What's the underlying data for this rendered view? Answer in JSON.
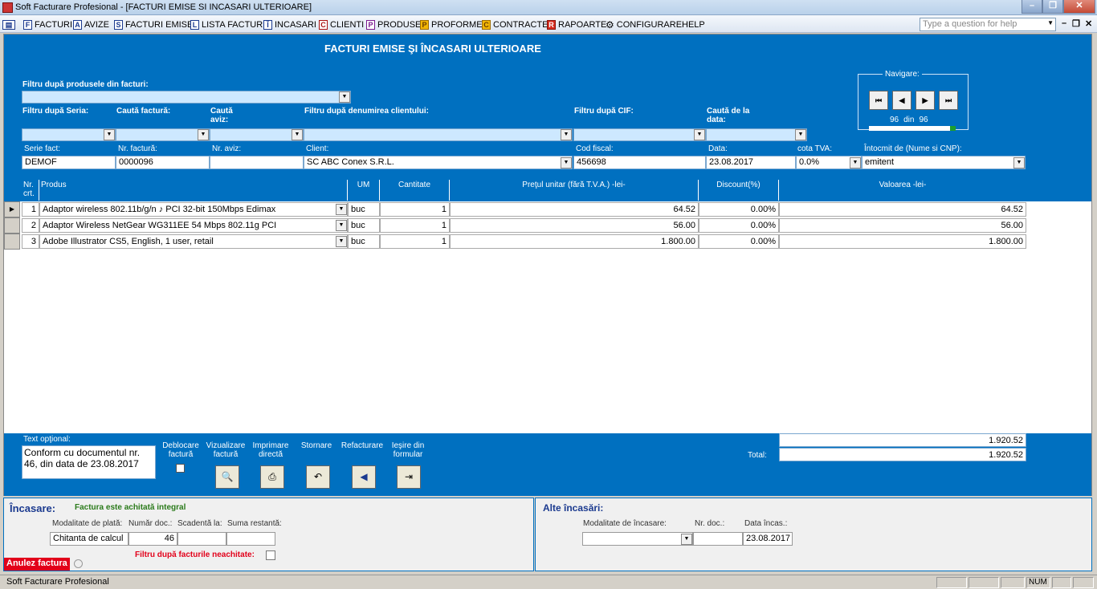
{
  "window": {
    "title": "Soft Facturare Profesional - [FACTURI EMISE SI INCASARI ULTERIOARE]"
  },
  "menu": {
    "items": [
      {
        "icon": "F",
        "label": "FACTURI"
      },
      {
        "icon": "A",
        "label": "AVIZE"
      },
      {
        "icon": "S",
        "label": "FACTURI EMISE"
      },
      {
        "icon": "L",
        "label": "LISTA FACTURI"
      },
      {
        "icon": "Î",
        "label": "INCASARI"
      },
      {
        "icon": "C",
        "label": "CLIENTI"
      },
      {
        "icon": "P",
        "label": "PRODUSE"
      },
      {
        "icon": "P",
        "label": "PROFORME"
      },
      {
        "icon": "C",
        "label": "CONTRACTE"
      },
      {
        "icon": "R",
        "label": "RAPOARTE"
      },
      {
        "icon": "",
        "label": "CONFIGURARE"
      },
      {
        "icon": "",
        "label": "HELP"
      }
    ],
    "help_placeholder": "Type a question for help"
  },
  "form": {
    "heading": "FACTURI EMISE ŞI ÎNCASARI ULTERIOARE",
    "filters": {
      "produse_label": "Filtru după produsele din facturi:",
      "serie_label": "Filtru după Seria:",
      "cauta_factura_label": "Caută factură:",
      "cauta_aviz_label": "Caută aviz:",
      "client_label": "Filtru după denumirea clientului:",
      "cif_label": "Filtru după CIF:",
      "data_label": "Caută de la data:"
    },
    "navigare": {
      "label": "Navigare:",
      "current": "96",
      "word": "din",
      "total": "96",
      "progress": 1.0
    },
    "invoice": {
      "serie_label": "Serie fact:",
      "serie": "DEMOF",
      "nr_label": "Nr. factură:",
      "nr": "0000096",
      "aviz_label": "Nr. aviz:",
      "aviz": "",
      "client_label": "Client:",
      "client": "SC ABC Conex S.R.L.",
      "cif_label": "Cod fiscal:",
      "cif": "456698",
      "data_label": "Data:",
      "data": "23.08.2017",
      "tva_label": "cota TVA:",
      "tva": "0.0%",
      "intocmit_label": "Întocmit de (Nume si CNP):",
      "intocmit": "emitent"
    },
    "table": {
      "headers": {
        "nr": "Nr. crt.",
        "produs": "Produs",
        "um": "UM",
        "cantitate": "Cantitate",
        "pret": "Preţul unitar (fără T.V.A.) -lei-",
        "discount": "Discount(%)",
        "valoare": "Valoarea -lei-"
      },
      "rows": [
        {
          "nr": "1",
          "produs": "Adaptor wireless 802.11b/g/n ♪ PCI 32-bit 150Mbps Edimax",
          "um": "buc",
          "cantitate": "1",
          "pret": "64.52",
          "discount": "0.00%",
          "valoare": "64.52"
        },
        {
          "nr": "2",
          "produs": "Adaptor Wireless NetGear WG311EE 54 Mbps 802.11g PCI",
          "um": "buc",
          "cantitate": "1",
          "pret": "56.00",
          "discount": "0.00%",
          "valoare": "56.00"
        },
        {
          "nr": "3",
          "produs": "Adobe Illustrator CS5, English, 1 user, retail",
          "um": "buc",
          "cantitate": "1",
          "pret": "1.800.00",
          "discount": "0.00%",
          "valoare": "1.800.00"
        }
      ]
    },
    "footer": {
      "text_label": "Text opţional:",
      "text_value": "Conform cu documentul nr. 46, din data de 23.08.2017",
      "actions": {
        "deblocare": "Deblocare factură",
        "vizualizare": "Vizualizare factură",
        "imprimare": "Imprimare directă",
        "stornare": "Stornare",
        "refacturare": "Refacturare",
        "iesire": "Ieşire din formular"
      },
      "subtotal": "1.920.52",
      "total_label": "Total:",
      "total": "1.920.52"
    }
  },
  "incasare": {
    "title": "Încasare:",
    "status": "Factura este achitată integral",
    "modalitate_label": "Modalitate de plată:",
    "nr_doc_label": "Număr doc.:",
    "scadenta_label": "Scadentă la:",
    "suma_label": "Suma restantă:",
    "modalitate": "Chitanta de calcul",
    "nr_doc": "46",
    "scadenta": "",
    "suma": "",
    "filtru_label": "Filtru după facturile neachitate:",
    "anulez": "Anulez factura"
  },
  "alte": {
    "title": "Alte încasări:",
    "modalitate_label": "Modalitate de încasare:",
    "nr_doc_label": "Nr. doc.:",
    "data_label": "Data încas.:",
    "modalitate": "",
    "nr_doc": "",
    "data": "23.08.2017"
  },
  "status": {
    "app": "Soft Facturare Profesional",
    "num": "NUM"
  },
  "colors": {
    "accent": "#0070c0",
    "filter_bg": "#cde8ff",
    "anulez": "#e2001a",
    "status_ok": "#2a7a1a",
    "status_warn": "#e2001a"
  }
}
